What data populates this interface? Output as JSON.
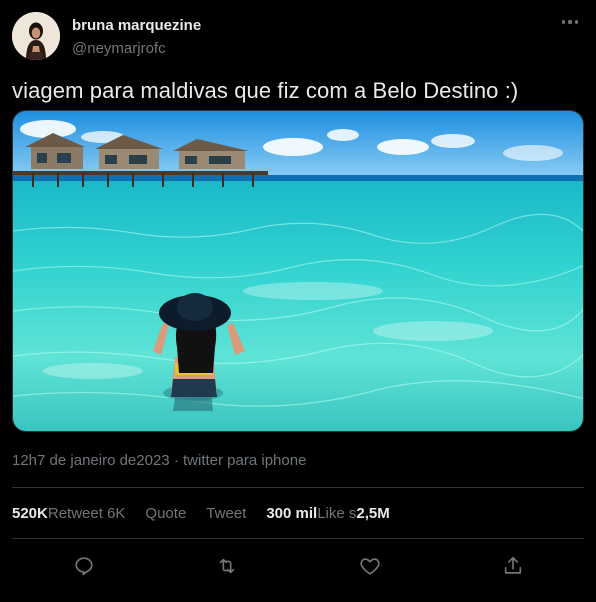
{
  "author": {
    "name": "bruna marquezine",
    "handle": "@neymarjrofc"
  },
  "tweet": {
    "text": "viagem para maldivas que fiz com a Belo Destino :)",
    "time": "12h",
    "date": "7 de janeiro de2023",
    "separator": " · ",
    "source": "twitter para iphone"
  },
  "stats": {
    "retweets_count": "520K",
    "retweets_label": "Retweet",
    "quotes_count": "6K",
    "quotes_label": "Quote",
    "tweet_label": "Tweet",
    "likes_count": "300 mil",
    "likes_label": "Like",
    "likes_suffix": "s",
    "views_count": "2,5M"
  },
  "icons": {
    "more": "more-dots-icon",
    "reply": "reply-icon",
    "retweet": "retweet-icon",
    "like": "heart-icon",
    "share": "share-icon"
  },
  "colors": {
    "background": "#000000",
    "text_primary": "#e7e9ea",
    "text_secondary": "#71767b",
    "divider": "#2f3336"
  }
}
